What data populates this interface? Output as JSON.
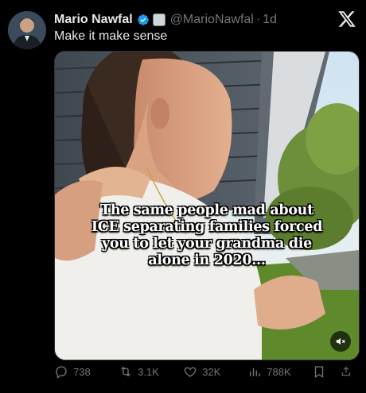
{
  "tweet": {
    "author_name": "Mario Nawfal",
    "handle": "@MarioNawfal",
    "separator": "·",
    "time": "1d",
    "text": "Make it make sense"
  },
  "media": {
    "caption_lines": [
      "The same people mad about",
      "ICE separating families forced",
      "you to let your grandma die",
      "alone in 2020..."
    ]
  },
  "actions": {
    "replies": "738",
    "reposts": "3.1K",
    "likes": "32K",
    "views": "788K"
  },
  "colors": {
    "background": "#000000",
    "text": "#e7e9ea",
    "muted": "#71767b",
    "verified": "#1d9bf0"
  },
  "icons": [
    "verified-badge-icon",
    "affiliate-badge-icon",
    "x-logo-icon",
    "mute-icon",
    "reply-icon",
    "repost-icon",
    "like-icon",
    "views-icon",
    "bookmark-icon",
    "share-icon"
  ]
}
